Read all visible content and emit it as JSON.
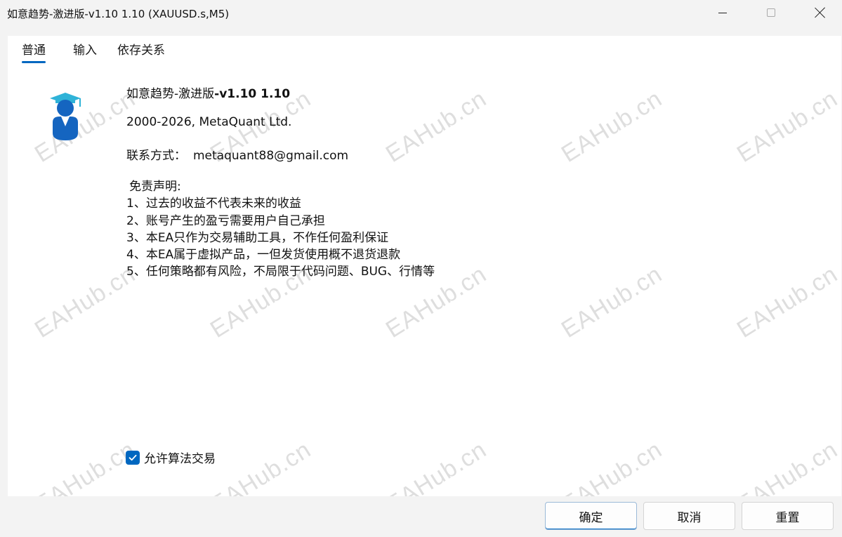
{
  "window": {
    "title": "如意趋势-激进版-v1.10 1.10 (XAUUSD.s,M5)"
  },
  "tabs": [
    {
      "label": "普通",
      "active": true
    },
    {
      "label": "输入",
      "active": false
    },
    {
      "label": "依存关系",
      "active": false
    }
  ],
  "ea": {
    "name_prefix": "如意趋势-激进版",
    "name_version": "-v1.10 1.10",
    "copyright": "2000-2026, MetaQuant Ltd.",
    "contact_label": "联系方式：",
    "contact_email": "metaquant88@gmail.com",
    "disclaimer": [
      "免责声明:",
      "1、过去的收益不代表未来的收益",
      "2、账号产生的盈亏需要用户自己承担",
      "3、本EA只作为交易辅助工具，不作任何盈利保证",
      "4、本EA属于虚拟产品，一但发货使用概不退货退款",
      "5、任何策略都有风险，不局限于代码问题、BUG、行情等"
    ]
  },
  "options": {
    "allow_algo_trading_label": "允许算法交易",
    "allow_algo_trading_checked": true
  },
  "buttons": {
    "ok": "确定",
    "cancel": "取消",
    "reset": "重置"
  },
  "watermark": {
    "text": "EAHub.cn"
  },
  "colors": {
    "accent": "#0067c0",
    "avatar_cap": "#2fb3d8",
    "avatar_body": "#1565c0"
  }
}
